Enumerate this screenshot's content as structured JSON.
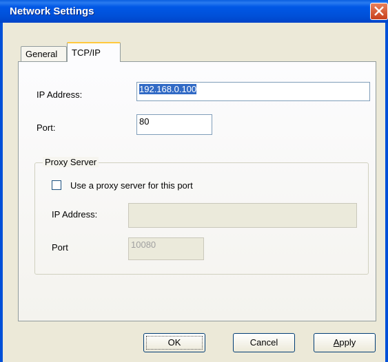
{
  "window": {
    "title": "Network Settings"
  },
  "tabs": [
    {
      "label": "General",
      "active": false
    },
    {
      "label": "TCP/IP",
      "active": true
    }
  ],
  "tcpip": {
    "ip_label": "IP Address:",
    "ip_value": "192.168.0.100",
    "port_label": "Port:",
    "port_value": "80"
  },
  "proxy": {
    "group_title": "Proxy Server",
    "checkbox_label": "Use a proxy server for this port",
    "checkbox_checked": false,
    "ip_label": "IP Address:",
    "ip_value": "",
    "port_label": "Port",
    "port_value": "10080"
  },
  "buttons": {
    "ok": "OK",
    "cancel": "Cancel",
    "apply_mnemonic": "A",
    "apply_rest": "pply"
  },
  "colors": {
    "title_bar": "#0054e3",
    "dialog_bg": "#ece9d8",
    "selection": "#316ac5",
    "tab_highlight": "#ffc83c"
  }
}
